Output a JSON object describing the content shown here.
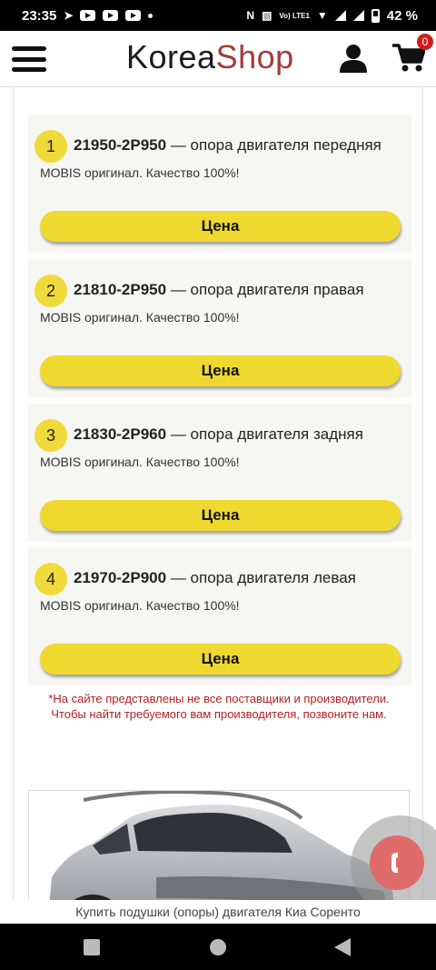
{
  "status_bar": {
    "time": "23:35",
    "battery": "42 %",
    "icons": [
      "telegram-icon",
      "youtube-icon",
      "youtube-icon",
      "youtube-icon",
      "dot-icon",
      "nfc-icon",
      "vibrate-icon",
      "volte-icon",
      "wifi-icon",
      "signal-icon",
      "signal-icon",
      "battery-icon"
    ],
    "volte_label": "Vo) LTE1"
  },
  "header": {
    "logo_part1": "Korea",
    "logo_part2": "Shop",
    "cart_count": "0",
    "brand_color": "#a33a3a",
    "icons": [
      "menu-icon",
      "user-icon",
      "cart-icon"
    ]
  },
  "products": [
    {
      "number": "1",
      "code": "21950-2P950",
      "name": " — опора двигателя передняя",
      "desc": "MOBIS оригинал. Качество 100%!",
      "button": "Цена"
    },
    {
      "number": "2",
      "code": "21810-2P950",
      "name": " — опора двигателя правая",
      "desc": "MOBIS оригинал. Качество 100%!",
      "button": "Цена"
    },
    {
      "number": "3",
      "code": "21830-2P960",
      "name": " — опора двигателя задняя",
      "desc": "MOBIS оригинал. Качество 100%!",
      "button": "Цена"
    },
    {
      "number": "4",
      "code": "21970-2P900",
      "name": " — опора двигателя левая",
      "desc": "MOBIS оригинал. Качество 100%!",
      "button": "Цена"
    }
  ],
  "note": {
    "line1": "*На сайте представлены не все поставщики и производители.",
    "line2": "Чтобы найти требуемого вам производителя, позвоните нам."
  },
  "caption": "Купить подушки (опоры) двигателя Киа Соренто",
  "colors": {
    "accent_yellow": "#efd92e",
    "call_button": "#e06b6b",
    "note_red": "#b32020"
  }
}
